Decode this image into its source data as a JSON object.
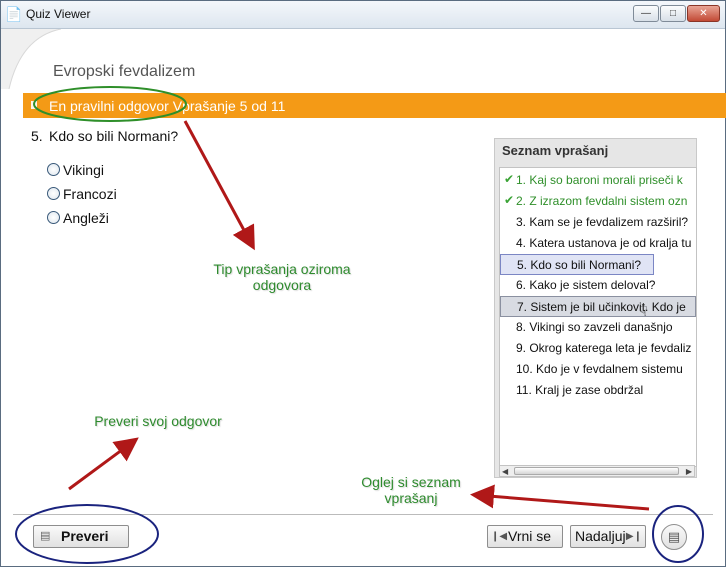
{
  "window": {
    "title": "Quiz Viewer"
  },
  "quiz": {
    "title": "Evropski fevdalizem",
    "question_type": "En pravilni odgovor",
    "question_progress": "Vprašanje 5 od 11",
    "question_number": "5.",
    "question_text": "Kdo so bili Normani?",
    "options": [
      "Vikingi",
      "Francozi",
      "Angleži"
    ]
  },
  "panel": {
    "title": "Seznam vprašanj",
    "items": [
      {
        "text": "1.  Kaj so baroni morali priseči k",
        "status": "answered"
      },
      {
        "text": "2.  Z izrazom fevdalni sistem ozn",
        "status": "answered"
      },
      {
        "text": "3.  Kam se je fevdalizem razširil?",
        "status": ""
      },
      {
        "text": "4.  Katera ustanova je od kralja tu",
        "status": ""
      },
      {
        "text": "5.  Kdo so bili Normani?",
        "status": "current"
      },
      {
        "text": "6.  Kako je sistem deloval?",
        "status": ""
      },
      {
        "text": "7.  Sistem je bil učinkovit. Kdo je",
        "status": "hover"
      },
      {
        "text": "8.  Vikingi so zavzeli današnjo",
        "status": ""
      },
      {
        "text": "9.  Okrog katerega leta je fevdaliz",
        "status": ""
      },
      {
        "text": "10.  Kdo je v fevdalnem sistemu",
        "status": ""
      },
      {
        "text": "11.  Kralj je zase obdržal",
        "status": ""
      }
    ]
  },
  "buttons": {
    "check": "Preveri",
    "back": "Vrni se",
    "next": "Nadaljuj"
  },
  "annotations": {
    "type_note": [
      "Tip vprašanja oziroma",
      "odgovora"
    ],
    "check_note": "Preveri svoj odgovor",
    "list_note": [
      "Oglej si seznam",
      "vprašanj"
    ]
  },
  "colors": {
    "accent_bar": "#f49a16",
    "annotation_green": "#2e8b2e",
    "arrow_red": "#b01818",
    "circle_navy": "#1a237e",
    "circle_green": "#2f8f2a"
  },
  "icons": {
    "app": "quiz-viewer-icon",
    "check": "notes-icon",
    "back": "arrow-left-icon",
    "next": "arrow-right-icon",
    "list": "question-list-icon",
    "answered": "checkmark-icon"
  }
}
